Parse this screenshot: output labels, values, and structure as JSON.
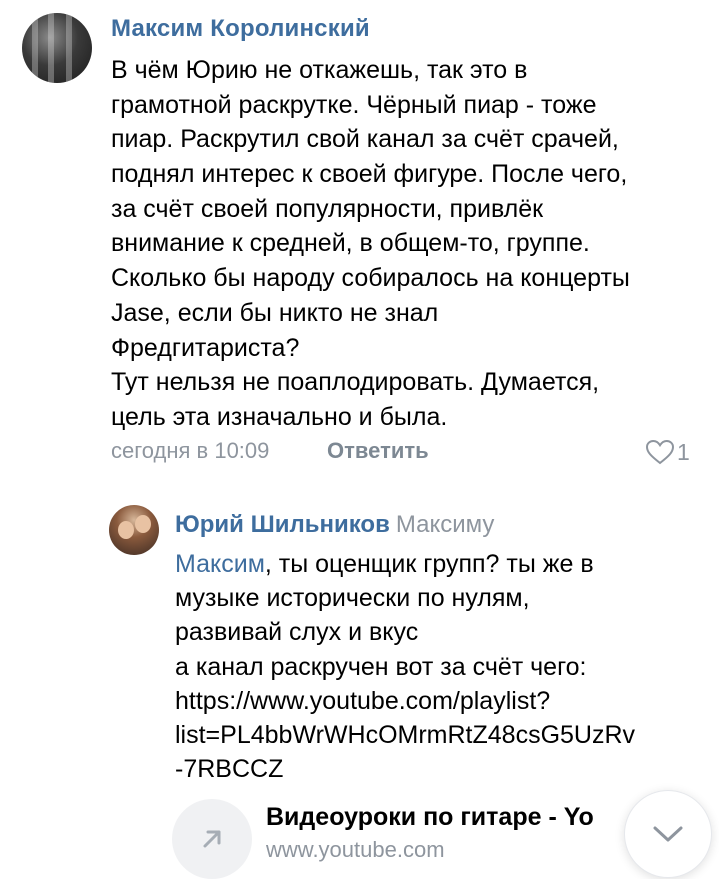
{
  "comment1": {
    "author": "Максим Королинский",
    "lines": [
      "В чём Юрию не откажешь, так это в",
      "грамотной раскрутке. Чёрный пиар - тоже",
      "пиар. Раскрутил свой канал за счёт срачей,",
      "поднял интерес к своей фигуре. После чего,",
      "за счёт своей популярности, привлёк",
      "внимание к средней, в общем-то, группе.",
      "Сколько бы народу собиралось на концерты",
      "Jase, если бы никто не знал",
      "Фредгитариста?",
      "Тут нельзя не поаплодировать. Думается,",
      "цель эта изначально и была."
    ],
    "timestamp": "сегодня в 10:09",
    "reply_label": "Ответить",
    "likes": "1"
  },
  "comment2": {
    "author": "Юрий Шильников",
    "reply_to": "Максиму",
    "mention": "Максим",
    "line1_rest": ", ты оценщик групп? ты же в",
    "lines": [
      "музыке исторически по нулям,",
      "развивай слух и вкус",
      "а канал раскручен вот за счёт чего:"
    ],
    "link_lines": [
      "https://www.youtube.com/playlist?",
      "list=PL4bbWrWHcOMrmRtZ48csG5UzRv",
      "-7RBCCZ"
    ]
  },
  "link_preview": {
    "title": "Видеоуроки по гитаре - Yo",
    "domain": "www.youtube.com",
    "icon": "arrow-up-right-icon"
  },
  "scroll_button": {
    "icon": "chevron-down-icon"
  },
  "colors": {
    "author": "#3e6d9e",
    "link": "#3e6d9e",
    "secondary": "#8e959e",
    "text": "#000000"
  }
}
